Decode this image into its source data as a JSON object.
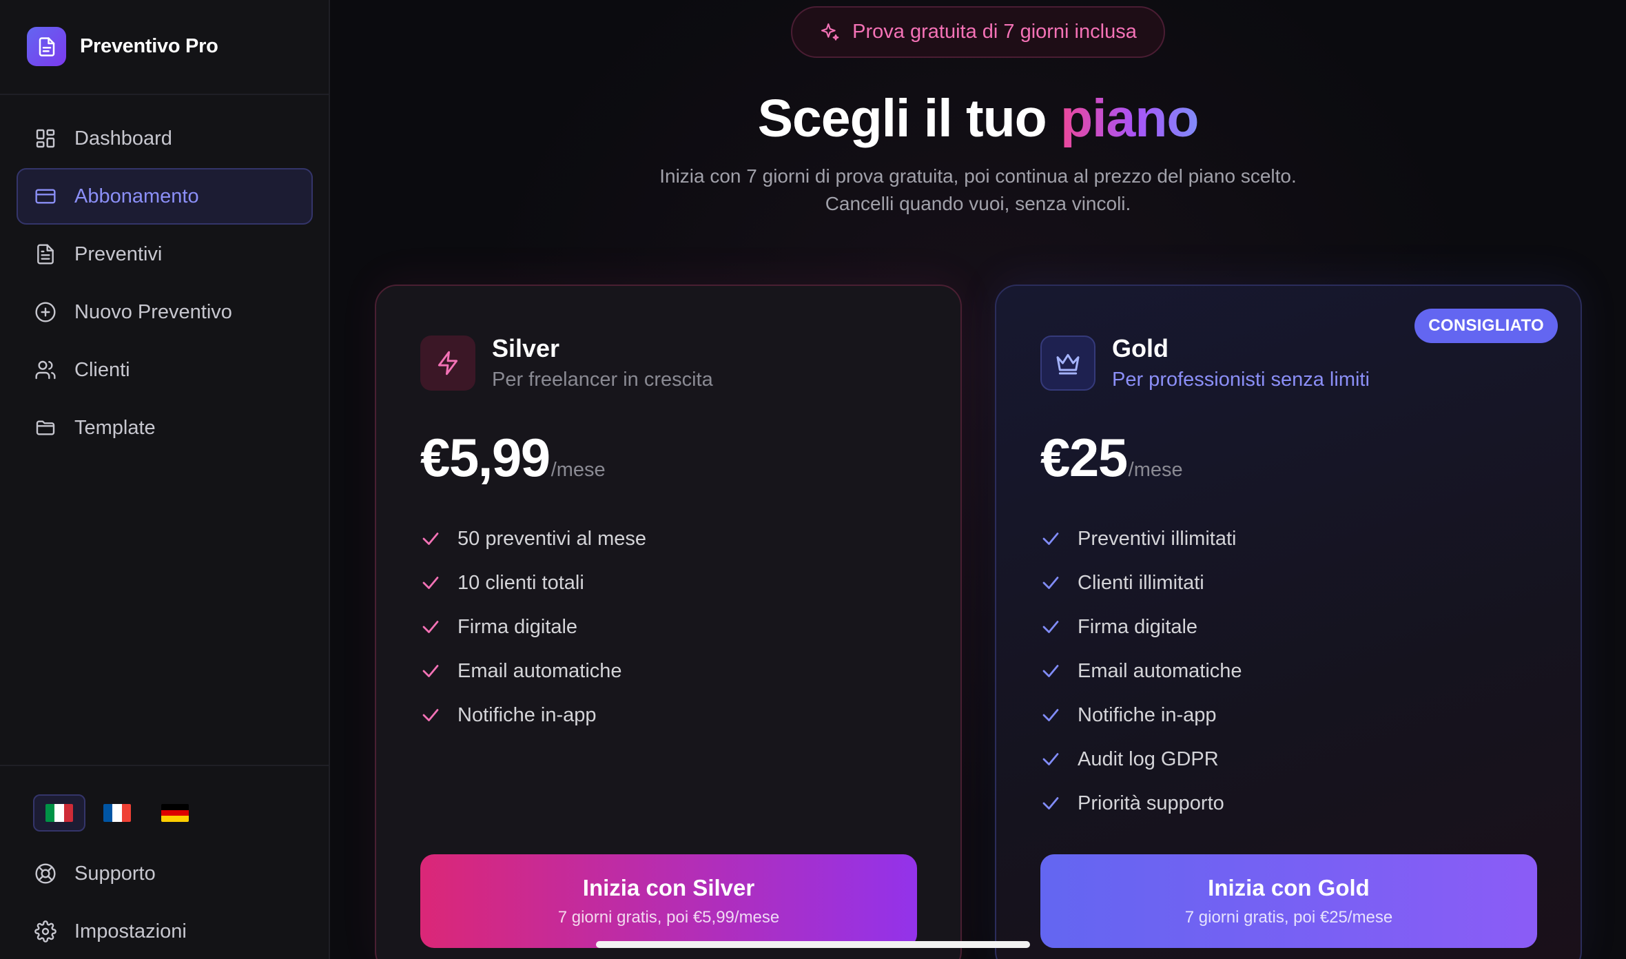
{
  "brand": {
    "name": "Preventivo Pro",
    "icon": "document-icon"
  },
  "sidebar": {
    "items": [
      {
        "label": "Dashboard",
        "icon": "grid-icon",
        "active": false
      },
      {
        "label": "Abbonamento",
        "icon": "credit-card-icon",
        "active": true
      },
      {
        "label": "Preventivi",
        "icon": "document-icon",
        "active": false
      },
      {
        "label": "Nuovo Preventivo",
        "icon": "plus-circle-icon",
        "active": false
      },
      {
        "label": "Clienti",
        "icon": "users-icon",
        "active": false
      },
      {
        "label": "Template",
        "icon": "folder-icon",
        "active": false
      }
    ],
    "languages": [
      {
        "code": "it",
        "active": true
      },
      {
        "code": "fr",
        "active": false
      },
      {
        "code": "de",
        "active": false
      }
    ],
    "bottom_items": [
      {
        "label": "Supporto",
        "icon": "lifebuoy-icon"
      },
      {
        "label": "Impostazioni",
        "icon": "gear-icon"
      }
    ]
  },
  "hero": {
    "trial_pill": "Prova gratuita di 7 giorni inclusa",
    "title_prefix": "Scegli il tuo ",
    "title_highlight": "piano",
    "subtitle_line1": "Inizia con 7 giorni di prova gratuita, poi continua al prezzo del piano scelto.",
    "subtitle_line2": "Cancelli quando vuoi, senza vincoli."
  },
  "plans": [
    {
      "id": "silver",
      "name": "Silver",
      "description": "Per freelancer in crescita",
      "price": "€5,99",
      "unit": "/mese",
      "features": [
        "50 preventivi al mese",
        "10 clienti totali",
        "Firma digitale",
        "Email automatiche",
        "Notifiche in-app"
      ],
      "cta_title": "Inizia con Silver",
      "cta_sub": "7 giorni gratis, poi €5,99/mese",
      "accent": "#ec4899"
    },
    {
      "id": "gold",
      "name": "Gold",
      "description": "Per professionisti senza limiti",
      "badge": "CONSIGLIATO",
      "price": "€25",
      "unit": "/mese",
      "features": [
        "Preventivi illimitati",
        "Clienti illimitati",
        "Firma digitale",
        "Email automatiche",
        "Notifiche in-app",
        "Audit log GDPR",
        "Priorità supporto"
      ],
      "cta_title": "Inizia con Gold",
      "cta_sub": "7 giorni gratis, poi €25/mese",
      "accent": "#818cf8"
    }
  ]
}
